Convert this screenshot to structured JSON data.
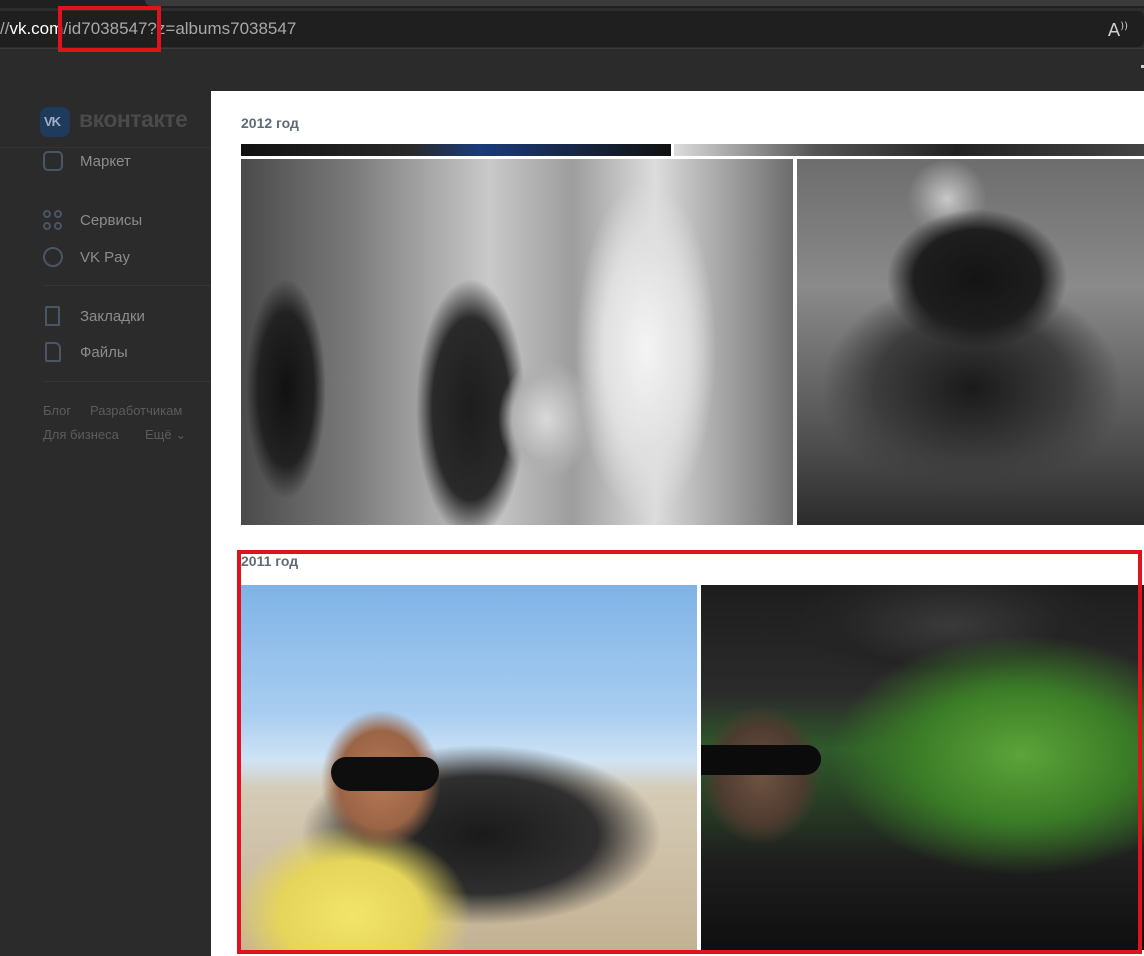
{
  "browser": {
    "url_prefix": "//",
    "url_host": "vk.com",
    "url_path": "/id7038547?z=albums7038547",
    "read_aloud_icon": "read-aloud-icon"
  },
  "sidebar": {
    "brand": "вконтакте",
    "logo_text": "VK",
    "items": [
      {
        "label": "Маркет",
        "icon": "bag-icon"
      },
      {
        "label": "Сервисы",
        "icon": "services-grid-icon"
      },
      {
        "label": "VK Pay",
        "icon": "vkpay-icon"
      },
      {
        "label": "Закладки",
        "icon": "bookmark-icon"
      },
      {
        "label": "Файлы",
        "icon": "file-icon"
      }
    ],
    "footer": {
      "blog": "Блог",
      "developers": "Разработчикам",
      "business": "Для бизнеса",
      "more": "Ещё"
    }
  },
  "albums": [
    {
      "year": "2012 год"
    },
    {
      "year": "2011 год"
    }
  ],
  "colors": {
    "highlight": "#e0131d",
    "year_label": "#5f6b78"
  }
}
